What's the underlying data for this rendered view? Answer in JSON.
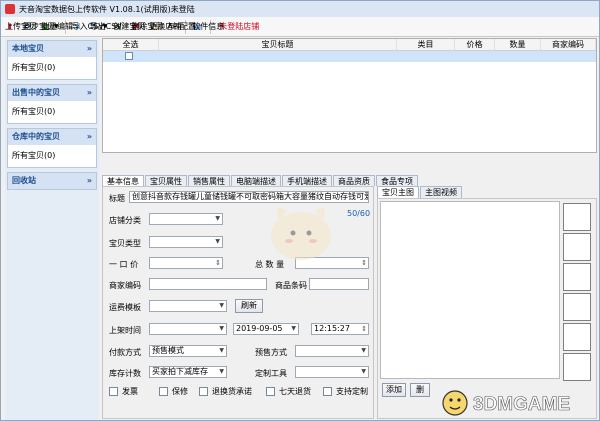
{
  "window": {
    "title": "天音淘宝数据包上传软件 V1.08.1(试用版)未登陆"
  },
  "toolbar": {
    "upload": "上传宝贝",
    "sync": "同步宝贝",
    "batch_edit": "批量编辑",
    "import_csv": "导入CSV",
    "export_csv": "导出CSV",
    "create": "创建宝贝",
    "delete": "删除宝贝",
    "change_shop": "更换店铺",
    "api_config": "API配置",
    "software_info": "软件信息",
    "unlogged_shop": "未登陆店铺"
  },
  "sidebar": {
    "groups": [
      {
        "title": "本地宝贝",
        "item": "所有宝贝(0)"
      },
      {
        "title": "出售中的宝贝",
        "item": "所有宝贝(0)"
      },
      {
        "title": "仓库中的宝贝",
        "item": "所有宝贝(0)"
      },
      {
        "title": "回收站",
        "item": ""
      }
    ]
  },
  "grid": {
    "columns": [
      "全选",
      "宝贝标题",
      "类目",
      "价格",
      "数量",
      "商家编码"
    ]
  },
  "tabs": [
    "基本信息",
    "宝贝属性",
    "销售属性",
    "电脑端描述",
    "手机端描述",
    "商品资质",
    "食品专项"
  ],
  "form": {
    "title_label": "标题",
    "title_value": "创意抖音款存钱罐儿童储钱罐不可取密码箱大容量猪纹自动存钱可爱",
    "char_count": "50/60",
    "shop_category_label": "店铺分类",
    "type_label": "宝贝类型",
    "price_label": "一  口  价",
    "qty_label": "总  数  量",
    "merchant_code_label": "商家编码",
    "barcode_label": "商品条码",
    "shipping_label": "运费模板",
    "refresh_btn": "刷新",
    "listing_time_label": "上架时间",
    "date_value": "2019-09-05",
    "time_value": "12:15:27",
    "payment_label": "付款方式",
    "payment_value": "预售模式",
    "presale_label": "预售方式",
    "stock_label": "库存计数",
    "stock_value": "买家拍下减库存",
    "custom_tool_label": "定制工具",
    "checkboxes": [
      "发票",
      "保修",
      "退换货承诺",
      "七天退货",
      "支持定制"
    ]
  },
  "right_panel": {
    "tabs": [
      "宝贝主图",
      "主图视频"
    ],
    "add_btn": "添加",
    "second_btn": "删"
  },
  "watermark": "3DMGAME"
}
